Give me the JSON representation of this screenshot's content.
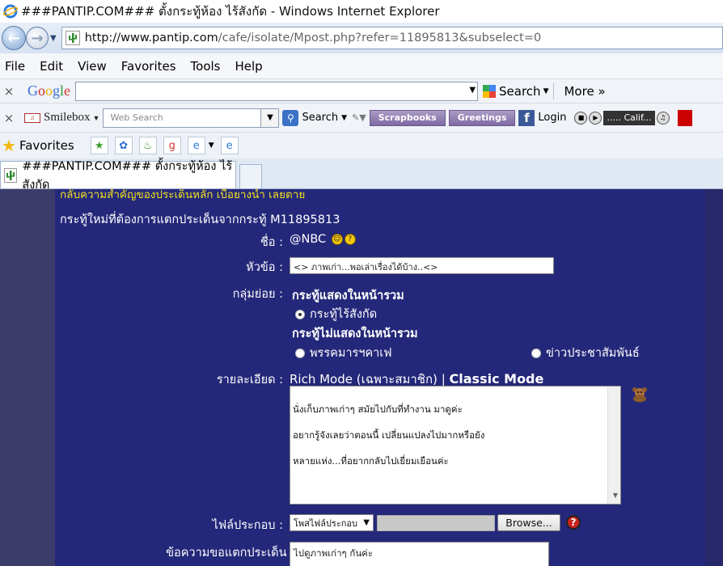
{
  "window": {
    "title": "###PANTIP.COM### ตั้งกระทู้ห้อง ไร้สังกัด - Windows Internet Explorer"
  },
  "address": {
    "url_prefix": "http://www.pantip.com",
    "url_path": "/cafe/isolate/Mpost.php?refer=11895813&subselect=0"
  },
  "menu": [
    "File",
    "Edit",
    "View",
    "Favorites",
    "Tools",
    "Help"
  ],
  "google_toolbar": {
    "logo": "Google",
    "search_label": "Search",
    "more_label": "More »"
  },
  "smilebox_toolbar": {
    "brand": "Smilebox",
    "web_search_placeholder": "Web Search",
    "search_label": "Search",
    "scrapbooks": "Scrapbooks",
    "greetings": "Greetings",
    "login": "Login",
    "player_station": "..... Calif..."
  },
  "favorites": {
    "label": "Favorites"
  },
  "tab": {
    "title": "###PANTIP.COM### ตั้งกระทู้ห้อง ไร้สังกัด"
  },
  "page": {
    "cut_text": "กลับความสำคัญของประเด็นหลัก เบื่อยางนำ เลยตาย",
    "headline": "กระทู้ใหม่ที่ต้องการแตกประเด็นจากกระทู้ M11895813",
    "name_label": "ชื่อ :",
    "name_value": "@NBC",
    "subject_label": "หัวข้อ :",
    "subject_value": "<> ภาพเก่า...พอเล่าเรื่องได้บ้าง..<>",
    "group_label": "กลุ่มย่อย :",
    "group_shown_heading": "กระทู้แสดงในหน้ารวม",
    "group_option_isolate": "กระทู้ไร้สังกัด",
    "group_hidden_heading": "กระทู้ไม่แสดงในหน้ารวม",
    "group_option_cafe": "พรรคมารฯคาเฟ",
    "group_option_pr": "ข่าวประชาสัมพันธ์",
    "detail_label": "รายละเอียด :",
    "rich_mode": "Rich Mode (เฉพาะสมาชิก)",
    "mode_sep": "|",
    "classic_mode": "Classic Mode",
    "detail_text": "นั่งเก็บภาพเก่าๆ สมัยไปกับที่ทำงาน มาดูค่ะ\n\nอยากรู้จังเลยว่าตอนนี้ เปลี่ยนแปลงไปมากหรือยัง\n\nหลายแห่ง...ที่อยากกลับไปเยี่ยมเยือนค่ะ",
    "attach_label": "ไฟล์ประกอบ :",
    "attach_select": "โพสไฟล์ประกอบ",
    "browse_label": "Browse...",
    "split_label": "ข้อความขอแตกประเด็น :",
    "split_value": "ไปดูภาพเก่าๆ กันค่ะ"
  },
  "colors": {
    "page_bg": "#24287a",
    "cut_text": "#f0e020"
  }
}
